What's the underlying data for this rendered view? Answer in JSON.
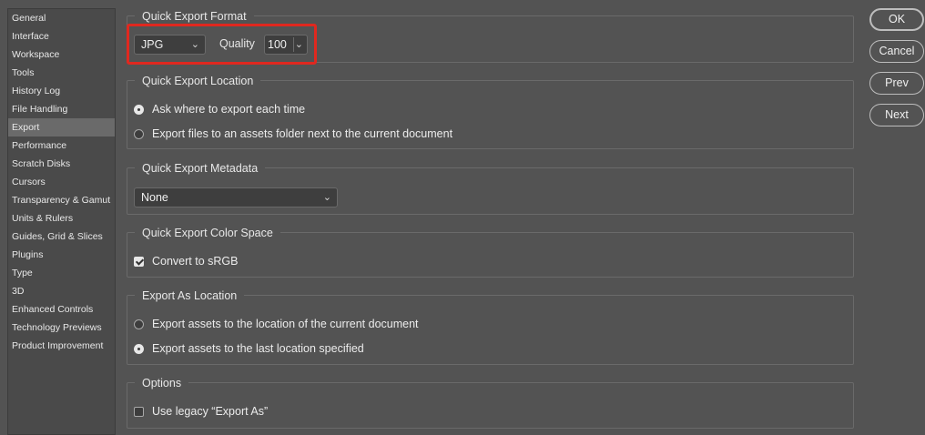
{
  "sidebar": {
    "items": [
      {
        "label": "General"
      },
      {
        "label": "Interface"
      },
      {
        "label": "Workspace"
      },
      {
        "label": "Tools"
      },
      {
        "label": "History Log"
      },
      {
        "label": "File Handling"
      },
      {
        "label": "Export",
        "selected": true
      },
      {
        "label": "Performance"
      },
      {
        "label": "Scratch Disks"
      },
      {
        "label": "Cursors"
      },
      {
        "label": "Transparency & Gamut"
      },
      {
        "label": "Units & Rulers"
      },
      {
        "label": "Guides, Grid & Slices"
      },
      {
        "label": "Plugins"
      },
      {
        "label": "Type"
      },
      {
        "label": "3D"
      },
      {
        "label": "Enhanced Controls"
      },
      {
        "label": "Technology Previews"
      },
      {
        "label": "Product Improvement"
      }
    ]
  },
  "format": {
    "title": "Quick Export Format",
    "format_value": "JPG",
    "quality_label": "Quality",
    "quality_value": "100"
  },
  "location": {
    "title": "Quick Export Location",
    "opt_ask": "Ask where to export each time",
    "opt_assets": "Export files to an assets folder next to the current document",
    "selected": "ask"
  },
  "metadata": {
    "title": "Quick Export Metadata",
    "value": "None"
  },
  "colorspace": {
    "title": "Quick Export Color Space",
    "convert_label": "Convert to sRGB",
    "convert_checked": true
  },
  "exportas": {
    "title": "Export As Location",
    "opt_current": "Export assets to the location of the current document",
    "opt_last": "Export assets to the last location specified",
    "selected": "last"
  },
  "options": {
    "title": "Options",
    "legacy_label": "Use legacy “Export As”",
    "legacy_checked": false
  },
  "buttons": {
    "ok": "OK",
    "cancel": "Cancel",
    "prev": "Prev",
    "next": "Next"
  },
  "colors": {
    "background": "#535353",
    "highlight": "#e0281f"
  }
}
